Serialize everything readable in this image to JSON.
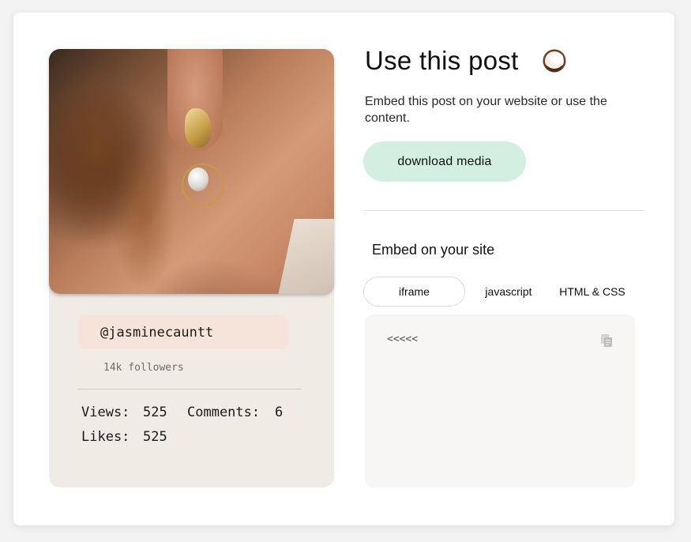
{
  "post": {
    "handle": "@jasminecauntt",
    "followers": "14k followers",
    "views_label": "Views:",
    "views": "525",
    "comments_label": "Comments:",
    "comments": "6",
    "likes_label": "Likes:",
    "likes": "525"
  },
  "panel": {
    "title": "Use this post",
    "title_icon": "coconut-icon",
    "description": "Embed this post on your website or use the content.",
    "download_label": "download media"
  },
  "embed": {
    "title": "Embed on your site",
    "tabs": [
      {
        "label": "iframe",
        "active": true
      },
      {
        "label": "javascript",
        "active": false
      },
      {
        "label": "HTML & CSS",
        "active": false
      }
    ],
    "code": "<<<<<",
    "copy_icon": "copy-icon"
  },
  "colors": {
    "card_bg": "#f0ebe5",
    "handle_pill": "#f6e4da",
    "download_button": "#d3efe1",
    "code_box": "#f7f6f5"
  }
}
